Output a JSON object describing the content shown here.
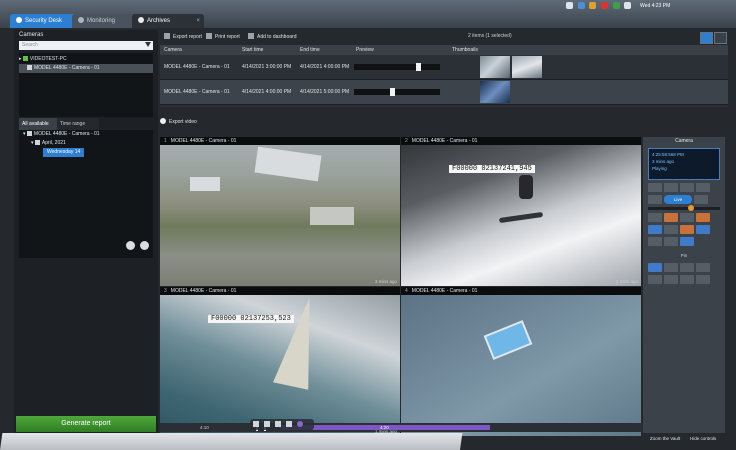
{
  "tabs": [
    {
      "label": "Security Desk"
    },
    {
      "label": "Monitoring"
    },
    {
      "label": "Archives"
    }
  ],
  "clock": "Wed 4:23 PM",
  "left": {
    "cameras_header": "Cameras",
    "search_placeholder": "Search",
    "tree": [
      "VIDEOTEST-PC",
      "MODEL 4480E - Camera - 01"
    ],
    "filter_tabs": [
      "All available",
      "Time range"
    ],
    "filter_tree": [
      "MODEL 4480E - Camera - 01",
      "April, 2021",
      "Wednesday 14"
    ],
    "generate_label": "Generate report"
  },
  "toolbar": {
    "export": "Export report",
    "print": "Print report",
    "dashboard": "Add to dashboard",
    "items_count": "2 items (1 selected)"
  },
  "table": {
    "headers": [
      "Camera",
      "Start time",
      "End time",
      "Preview",
      "Thumbnails"
    ],
    "rows": [
      {
        "camera": "MODEL 4480E - Camera - 01",
        "start": "4/14/2021 3:00:00 PM",
        "end": "4/14/2021 4:00:00 PM",
        "marker": 0.72
      },
      {
        "camera": "MODEL 4480E - Camera - 01",
        "start": "4/14/2021 4:00:00 PM",
        "end": "4/14/2021 5:00:00 PM",
        "marker": 0.42
      }
    ]
  },
  "export_video": "Export video",
  "tiles": [
    {
      "num": "1",
      "name": "MODEL 4480E - Camera - 01",
      "ago": "3 mins ago"
    },
    {
      "num": "2",
      "name": "MODEL 4480E - Camera - 01",
      "ago": "2 mins ago",
      "stamp": "F00000 02137241,945"
    },
    {
      "num": "3",
      "name": "MODEL 4480E - Camera - 01",
      "ago": "1 mins ago",
      "stamp": "F00000 02137253,523"
    },
    {
      "num": "4",
      "name": "MODEL 4480E - Camera - 01",
      "ago": ""
    }
  ],
  "timeline_labels": [
    "4:10",
    "4:20"
  ],
  "controls": {
    "title": "Camera",
    "screen": [
      "4:25:58:568 PM",
      "3 mins ago",
      "Playing"
    ],
    "live": "Live",
    "ptz": "Pin"
  },
  "status": {
    "zoom": "Zoom the Vault",
    "hide": "Hide controls"
  },
  "colors": {
    "accent": "#2c7fd1",
    "generate": "#3f9a2e",
    "timeline": "#7f56c6"
  }
}
